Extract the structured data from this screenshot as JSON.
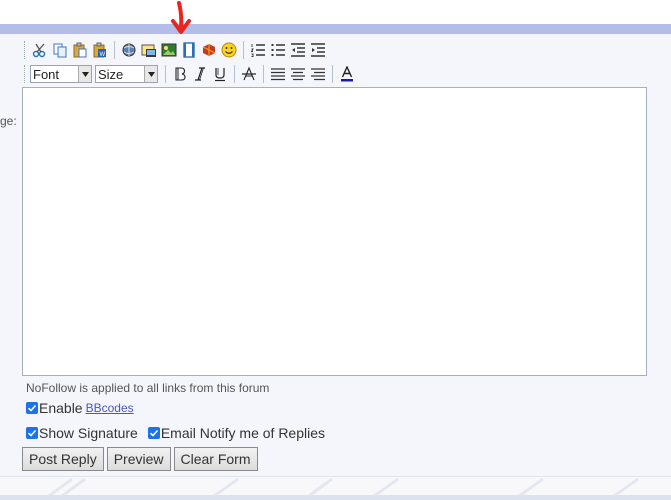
{
  "colors": {
    "accent_bar": "#b3bde8",
    "arrow": "#e8251f",
    "checkbox": "#1a73e8",
    "link": "#4a55c0"
  },
  "annotation": {
    "icon": "red-down-arrow-icon"
  },
  "toolbar": {
    "row1_icons": [
      "cut-icon",
      "copy-icon",
      "paste-icon",
      "paste-from-word-icon",
      "link-icon",
      "image-icon",
      "insert-picture-icon",
      "video-icon",
      "flash-icon",
      "smiley-icon",
      "ordered-list-icon",
      "unordered-list-icon",
      "outdent-icon",
      "indent-icon"
    ],
    "font_select": "Font",
    "size_select": "Size",
    "row2_icons": [
      "bold-icon",
      "italic-icon",
      "underline-icon",
      "strikethrough-icon",
      "align-left-icon",
      "align-center-icon",
      "align-right-icon",
      "font-color-icon"
    ]
  },
  "message_label": "ge:",
  "nofollow_note": "NoFollow is applied to all links from this forum",
  "options": {
    "enable_label": "Enable",
    "bbcodes_link": "BBcodes",
    "show_signature": "Show Signature",
    "email_notify": "Email Notify me of Replies"
  },
  "buttons": {
    "post_reply": "Post Reply",
    "preview": "Preview",
    "clear_form": "Clear Form"
  }
}
